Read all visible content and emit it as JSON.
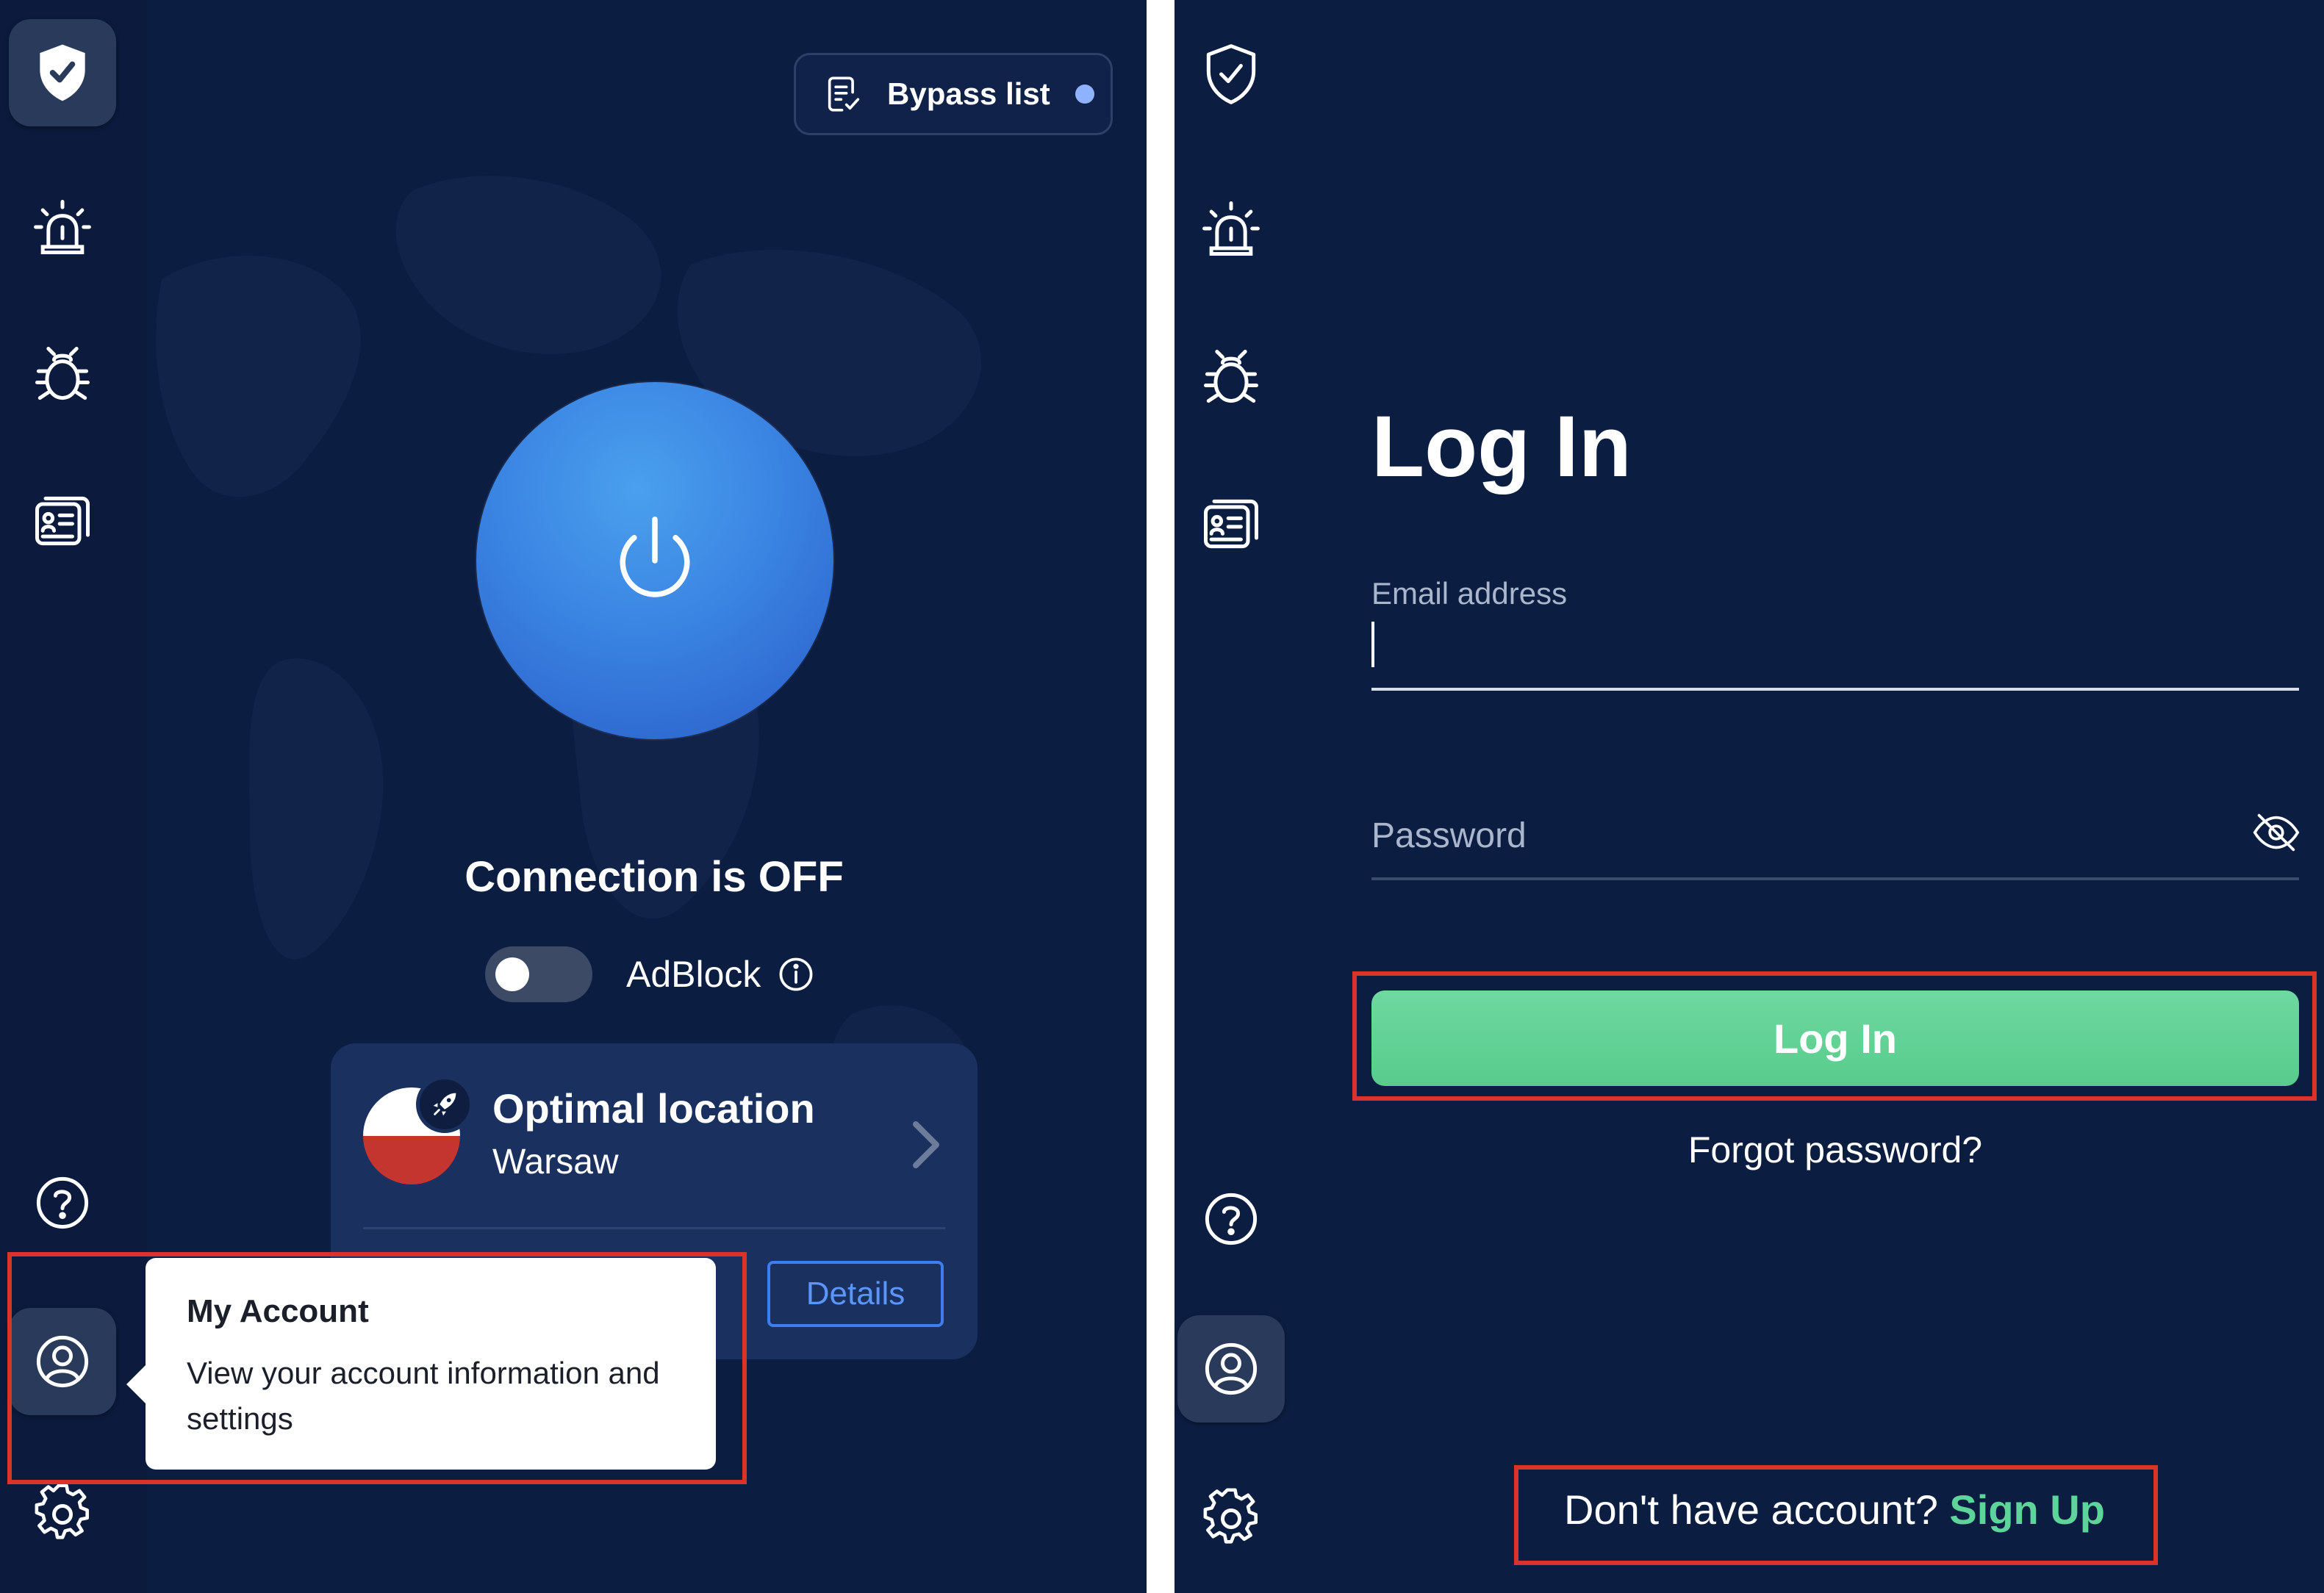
{
  "left": {
    "header": {
      "bypass_label": "Bypass list"
    },
    "connection": {
      "status": "Connection is OFF"
    },
    "adblock": {
      "label": "AdBlock",
      "enabled": false
    },
    "location": {
      "title": "Optimal location",
      "city": "Warsaw",
      "details_label": "Details"
    },
    "tooltip": {
      "title": "My Account",
      "body": "View your account information and settings"
    },
    "sidebar_icons": [
      "shield-check-icon",
      "alarm-icon",
      "bug-icon",
      "news-icon",
      "help-icon",
      "account-icon",
      "settings-icon"
    ]
  },
  "right": {
    "title": "Log In",
    "email": {
      "label": "Email address",
      "value": ""
    },
    "password": {
      "label": "Password",
      "value": ""
    },
    "login_button": "Log In",
    "forgot": "Forgot password?",
    "signup_prompt": "Don't have account?",
    "signup_link": "Sign Up"
  },
  "colors": {
    "background": "#0c1d42",
    "accent_green": "#5dd49a",
    "power_blue": "#3a84e2",
    "highlight_red": "#d9332c"
  }
}
